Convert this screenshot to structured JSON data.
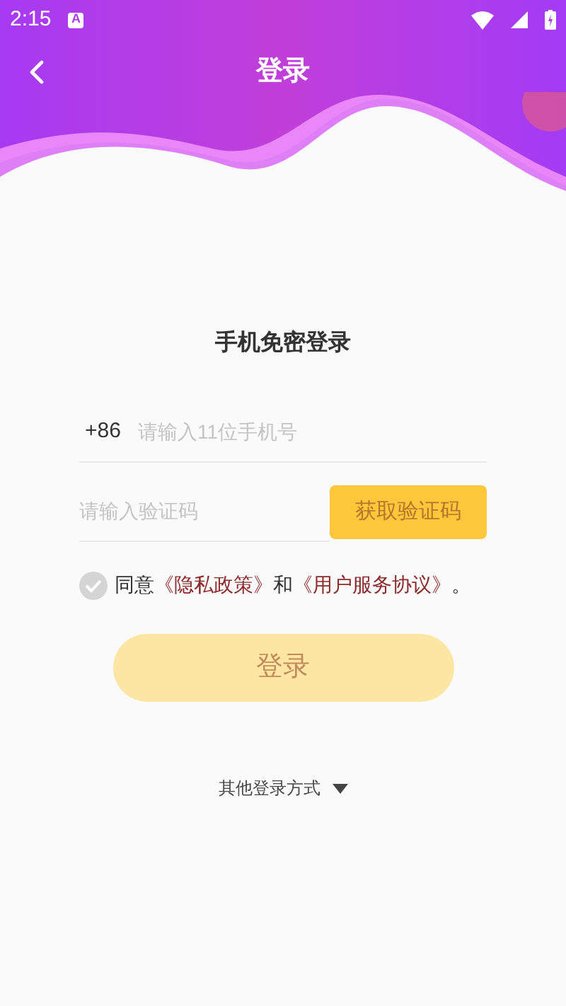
{
  "status_bar": {
    "time": "2:15",
    "notification": "A"
  },
  "header": {
    "title": "登录"
  },
  "form": {
    "heading": "手机免密登录",
    "phone": {
      "prefix": "+86",
      "placeholder": "请输入11位手机号"
    },
    "code": {
      "placeholder": "请输入验证码",
      "button": "获取验证码"
    },
    "agreement": {
      "checked": false,
      "prefix": "同意",
      "links": [
        "《隐私政策》",
        "《用户服务协议》"
      ],
      "joiner": "和",
      "suffix": "。"
    },
    "login_button": {
      "label": "登录",
      "disabled": true
    },
    "other_login": "其他登录方式"
  }
}
